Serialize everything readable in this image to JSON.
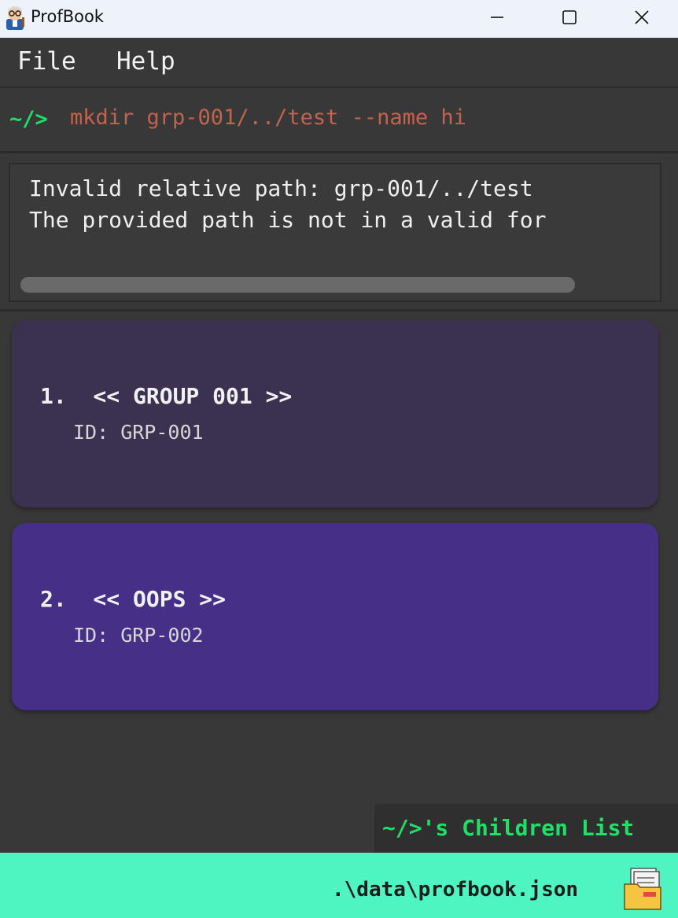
{
  "window": {
    "title": "ProfBook",
    "icons": {
      "app": "professor-avatar-icon",
      "minimize": "minimize-icon",
      "maximize": "maximize-icon",
      "close": "close-icon"
    }
  },
  "menu": {
    "items": [
      "File",
      "Help"
    ]
  },
  "command": {
    "prompt": "~/>",
    "value": "mkdir grp-001/../test --name hi"
  },
  "result": {
    "lines": [
      "Invalid relative path: grp-001/../test",
      "The provided path is not in a valid for"
    ]
  },
  "list": {
    "items": [
      {
        "index": "1.",
        "title": "1.  << GROUP 001 >>",
        "id": "ID: GRP-001",
        "color": "#3b3150"
      },
      {
        "index": "2.",
        "title": "2.  << OOPS >>",
        "id": "ID: GRP-002",
        "color": "#463087"
      }
    ],
    "label": "~/>'s Children List"
  },
  "status": {
    "path": ".\\data\\profbook.json",
    "icon": "folder-icon",
    "color": "#4ff5c0"
  },
  "colors": {
    "prompt": "#1ee066",
    "command_text": "#c4624c",
    "background": "#383838"
  }
}
